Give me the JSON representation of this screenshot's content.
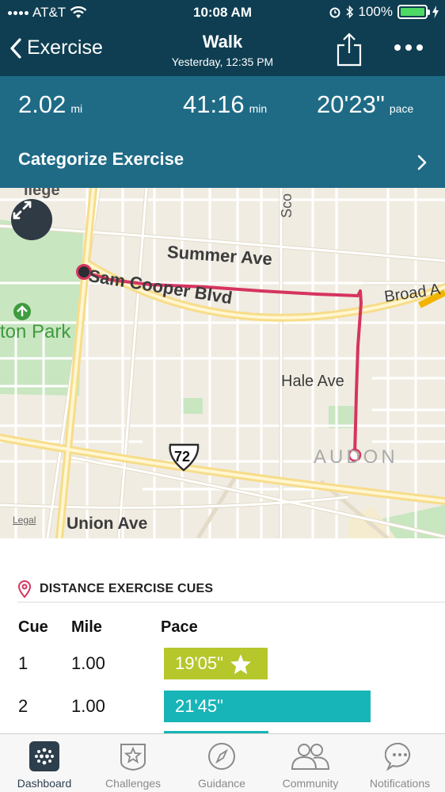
{
  "status_bar": {
    "carrier": "AT&T",
    "time": "10:08 AM",
    "battery": "100%"
  },
  "nav": {
    "back_label": "Exercise",
    "title": "Walk",
    "subtitle": "Yesterday, 12:35 PM"
  },
  "stats": {
    "distance": {
      "value": "2.02",
      "unit": "mi"
    },
    "duration": {
      "value": "41:16",
      "unit": "min"
    },
    "pace": {
      "value": "20'23\"",
      "unit": "pace"
    }
  },
  "categorize_label": "Categorize Exercise",
  "map": {
    "labels": {
      "summer_ave": "Summer Ave",
      "sam_cooper": "Sam Cooper Blvd",
      "broad": "Broad A",
      "hale": "Hale Ave",
      "park": "ton Park",
      "audon": "AUDON",
      "union": "Union Ave",
      "hwy": "72",
      "sco": "Sco",
      "top_frag": "llege"
    },
    "legal": "Legal"
  },
  "cues": {
    "title": "DISTANCE EXERCISE CUES",
    "headers": {
      "cue": "Cue",
      "mile": "Mile",
      "pace": "Pace"
    },
    "rows": [
      {
        "cue": "1",
        "mile": "1.00",
        "pace": "19'05\"",
        "fraction": 0.29,
        "color": "#b5c72b",
        "best": true
      },
      {
        "cue": "2",
        "mile": "1.00",
        "pace": "21'45\"",
        "fraction": 0.58,
        "color": "#17b5b8",
        "best": false
      }
    ]
  },
  "tabs": [
    {
      "label": "Dashboard",
      "icon": "dashboard-icon"
    },
    {
      "label": "Challenges",
      "icon": "challenges-icon"
    },
    {
      "label": "Guidance",
      "icon": "compass-icon"
    },
    {
      "label": "Community",
      "icon": "community-icon"
    },
    {
      "label": "Notifications",
      "icon": "notifications-icon"
    }
  ],
  "colors": {
    "header": "#0f3e52",
    "stats_band": "#1f6b86",
    "route": "#d6345f",
    "best_pace": "#b5c72b",
    "pace": "#17b5b8"
  }
}
